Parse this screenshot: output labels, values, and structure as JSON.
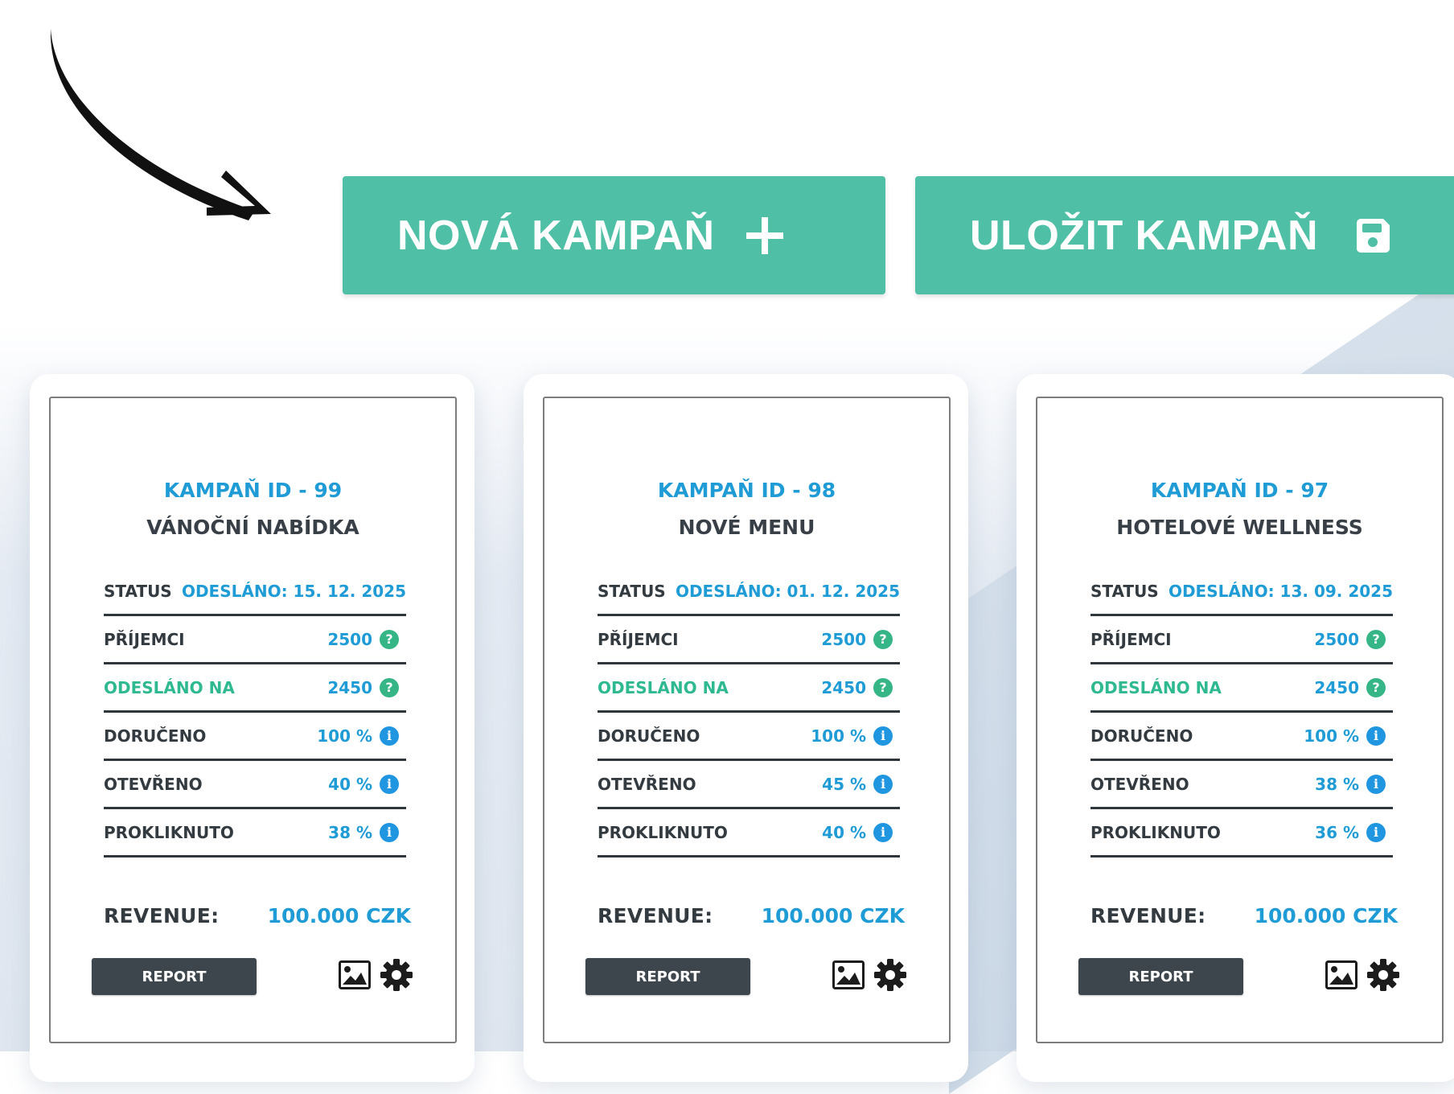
{
  "buttons": {
    "new_campaign": "NOVÁ KAMPAŇ",
    "save_campaign": "ULOŽIT KAMPAŇ"
  },
  "colors": {
    "accent_green": "#4fbfa5",
    "value_blue": "#1f9bd6",
    "dark": "#3d464c"
  },
  "campaigns": [
    {
      "id_label": "KAMPAŇ ID - 99",
      "name": "VÁNOČNÍ NABÍDKA",
      "status_label": "STATUS",
      "status_value": "ODESLÁNO: 15. 12. 2025",
      "rows": [
        {
          "label": "PŘÍJEMCI",
          "value": "2500",
          "icon": "help-icon"
        },
        {
          "label": "ODESLÁNO NA",
          "value": "2450",
          "icon": "help-icon"
        },
        {
          "label": "DORUČENO",
          "value": "100 %",
          "icon": "info-icon"
        },
        {
          "label": "OTEVŘENO",
          "value": "40 %",
          "icon": "info-icon"
        },
        {
          "label": "PROKLIKNUTO",
          "value": "38 %",
          "icon": "info-icon"
        }
      ],
      "revenue_label": "REVENUE:",
      "revenue_value": "100.000 CZK",
      "report_label": "REPORT"
    },
    {
      "id_label": "KAMPAŇ ID - 98",
      "name": "NOVÉ MENU",
      "status_label": "STATUS",
      "status_value": "ODESLÁNO: 01. 12. 2025",
      "rows": [
        {
          "label": "PŘÍJEMCI",
          "value": "2500",
          "icon": "help-icon"
        },
        {
          "label": "ODESLÁNO NA",
          "value": "2450",
          "icon": "help-icon"
        },
        {
          "label": "DORUČENO",
          "value": "100 %",
          "icon": "info-icon"
        },
        {
          "label": "OTEVŘENO",
          "value": "45 %",
          "icon": "info-icon"
        },
        {
          "label": "PROKLIKNUTO",
          "value": "40 %",
          "icon": "info-icon"
        }
      ],
      "revenue_label": "REVENUE:",
      "revenue_value": "100.000 CZK",
      "report_label": "REPORT"
    },
    {
      "id_label": "KAMPAŇ ID - 97",
      "name": "HOTELOVÉ WELLNESS",
      "status_label": "STATUS",
      "status_value": "ODESLÁNO: 13. 09. 2025",
      "rows": [
        {
          "label": "PŘÍJEMCI",
          "value": "2500",
          "icon": "help-icon"
        },
        {
          "label": "ODESLÁNO NA",
          "value": "2450",
          "icon": "help-icon"
        },
        {
          "label": "DORUČENO",
          "value": "100 %",
          "icon": "info-icon"
        },
        {
          "label": "OTEVŘENO",
          "value": "38 %",
          "icon": "info-icon"
        },
        {
          "label": "PROKLIKNUTO",
          "value": "36 %",
          "icon": "info-icon"
        }
      ],
      "revenue_label": "REVENUE:",
      "revenue_value": "100.000 CZK",
      "report_label": "REPORT"
    }
  ]
}
